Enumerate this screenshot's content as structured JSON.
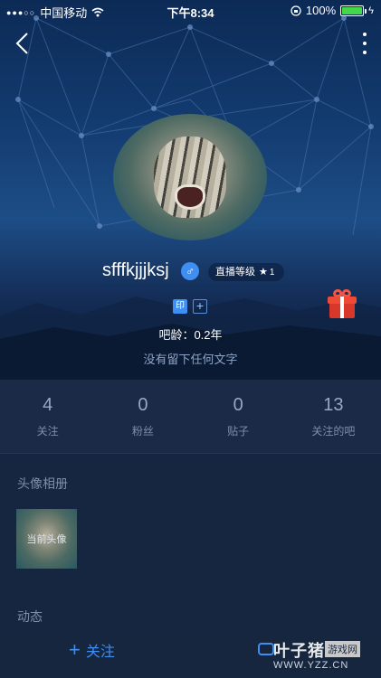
{
  "status_bar": {
    "signal": "●●●○○",
    "carrier": "中国移动",
    "wifi_icon": "wifi-icon",
    "time": "下午8:34",
    "battery_percent": "100%",
    "battery_level": 1.0,
    "battery_color": "#43d84a"
  },
  "header": {
    "back_icon": "chevron-left-icon",
    "more_icon": "more-vertical-icon"
  },
  "profile": {
    "username": "sfffkjjjksj",
    "gender_symbol": "♂",
    "live_level_label": "直播等级",
    "live_level_star": "★",
    "live_level_value": "1",
    "badge_print": "印",
    "badge_add": "+",
    "age": "吧龄：0.2年",
    "bio": "没有留下任何文字"
  },
  "stats": [
    {
      "value": "4",
      "label": "关注"
    },
    {
      "value": "0",
      "label": "粉丝"
    },
    {
      "value": "0",
      "label": "贴子"
    },
    {
      "value": "13",
      "label": "关注的吧"
    }
  ],
  "album": {
    "title": "头像相册",
    "thumb_label": "当前头像"
  },
  "activity": {
    "title": "动态"
  },
  "bottom_bar": {
    "follow_plus": "+",
    "follow_label": "关注"
  },
  "watermark": {
    "brand": "叶子猪",
    "tag": "游戏网",
    "url": "WWW.YZZ.CN"
  },
  "colors": {
    "accent": "#3f8ef2",
    "background": "#172640",
    "gift": "#d8382a"
  }
}
